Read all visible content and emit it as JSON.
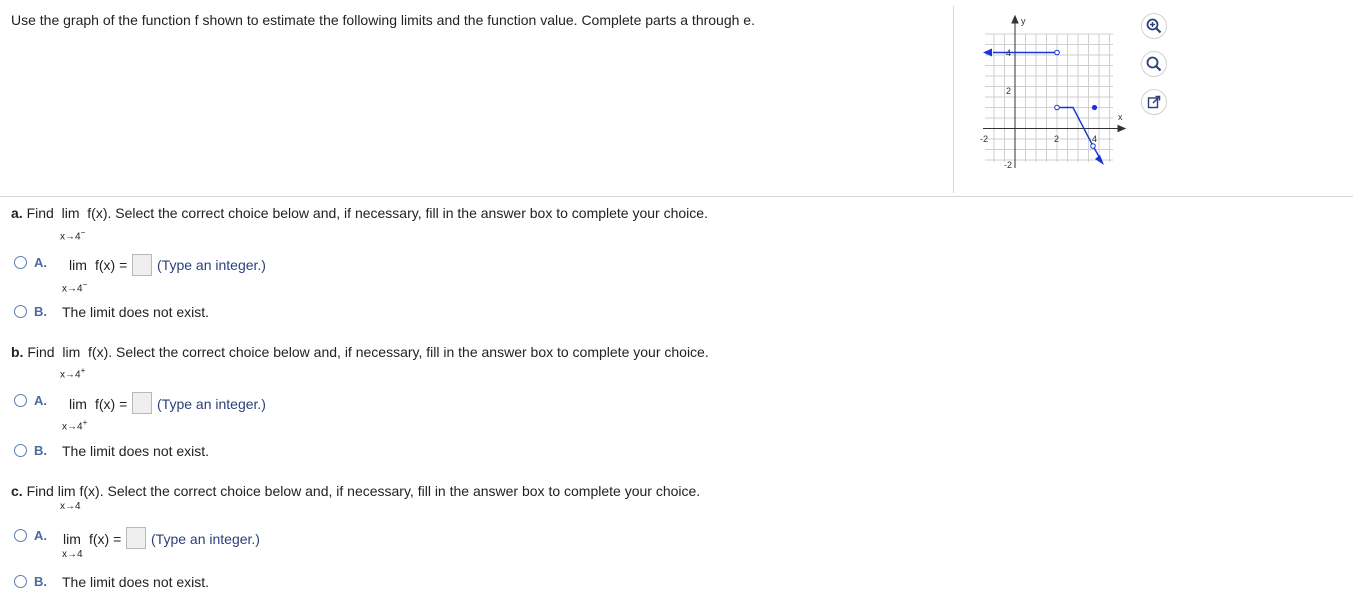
{
  "instructions": "Use the graph of the function f shown to estimate the following limits and the function value. Complete parts a through e.",
  "graph": {
    "axis_x_label": "x",
    "axis_y_label": "y",
    "tick_labels": {
      "y_4": "4",
      "y_2": "2",
      "y_neg2": "-2",
      "x_neg2": "-2",
      "x_2": "2",
      "x_4": "4"
    }
  },
  "toolbar": {
    "zoom_in": "zoom-in",
    "zoom_out": "zoom-out",
    "popout": "open-in-new-window"
  },
  "parts": [
    {
      "letter": "a.",
      "prompt_pre": "Find",
      "lim": "lim",
      "func": "f(x).",
      "prompt_post": "Select the correct choice below and, if necessary, fill in the answer box to complete your choice.",
      "approach": "x→4",
      "sign": "−",
      "option_a_letter": "A.",
      "option_a_lim": "lim",
      "option_a_eq": "f(x) =",
      "option_a_hint": "(Type an integer.)",
      "option_b_letter": "B.",
      "option_b_text": "The limit does not exist."
    },
    {
      "letter": "b.",
      "prompt_pre": "Find",
      "lim": "lim",
      "func": "f(x).",
      "prompt_post": "Select the correct choice below and, if necessary, fill in the answer box to complete your choice.",
      "approach": "x→4",
      "sign": "+",
      "option_a_letter": "A.",
      "option_a_lim": "lim",
      "option_a_eq": "f(x) =",
      "option_a_hint": "(Type an integer.)",
      "option_b_letter": "B.",
      "option_b_text": "The limit does not exist."
    },
    {
      "letter": "c.",
      "prompt_pre": "Find",
      "lim": "lim",
      "func": "f(x).",
      "prompt_post": "Select the correct choice below and, if necessary, fill in the answer box to complete your choice.",
      "approach": "x→4",
      "sign": "",
      "option_a_letter": "A.",
      "option_a_lim": "lim",
      "option_a_eq": "f(x) =",
      "option_a_hint": "(Type an integer.)",
      "option_b_letter": "B.",
      "option_b_text": "The limit does not exist."
    }
  ],
  "colors": {
    "curve": "#1a32d6",
    "accent": "#4a6aa0",
    "hint": "#2c3f7a"
  }
}
